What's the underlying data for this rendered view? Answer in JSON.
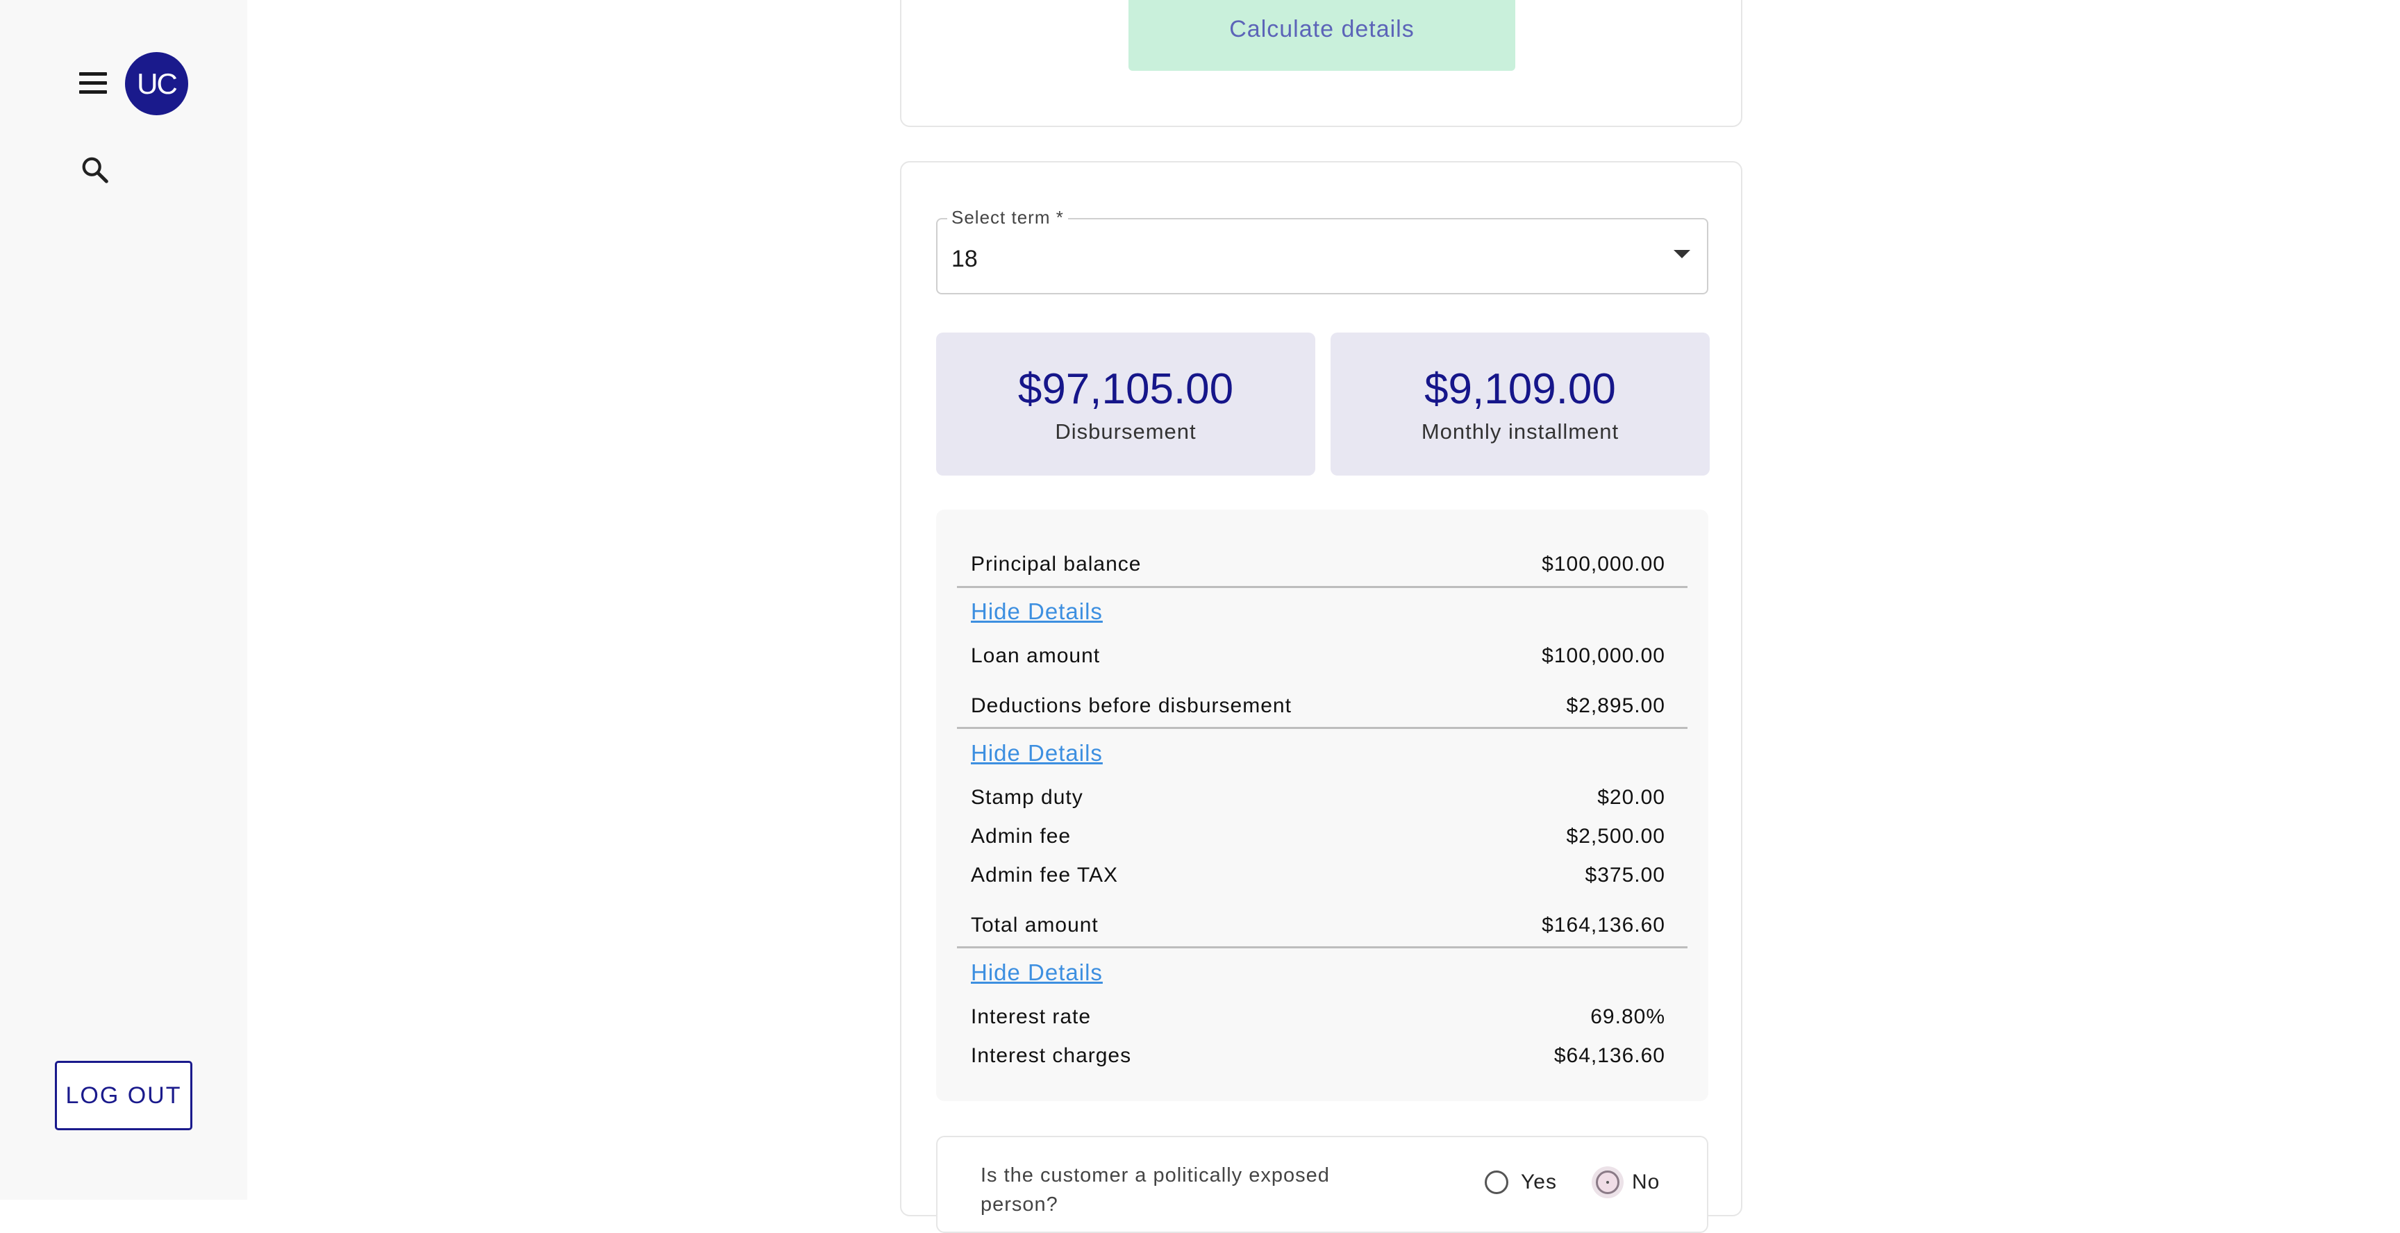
{
  "sidebar": {
    "avatar_initials": "UC",
    "logout_label": "LOG OUT"
  },
  "top_card": {
    "calculate_label": "Calculate details"
  },
  "term": {
    "label": "Select term *",
    "value": "18"
  },
  "summary": {
    "disbursement_amount": "$97,105.00",
    "disbursement_label": "Disbursement",
    "installment_amount": "$9,109.00",
    "installment_label": "Monthly installment"
  },
  "details": {
    "principal_label": "Principal balance",
    "principal_value": "$100,000.00",
    "hide_1": "Hide Details",
    "loan_amount_label": "Loan amount",
    "loan_amount_value": "$100,000.00",
    "deductions_label": "Deductions before disbursement",
    "deductions_value": "$2,895.00",
    "hide_2": "Hide Details",
    "stamp_duty_label": "Stamp duty",
    "stamp_duty_value": "$20.00",
    "admin_fee_label": "Admin fee",
    "admin_fee_value": "$2,500.00",
    "admin_fee_tax_label": "Admin fee TAX",
    "admin_fee_tax_value": "$375.00",
    "total_label": "Total amount",
    "total_value": "$164,136.60",
    "hide_3": "Hide Details",
    "interest_rate_label": "Interest rate",
    "interest_rate_value": "69.80%",
    "interest_charges_label": "Interest charges",
    "interest_charges_value": "$64,136.60"
  },
  "pep": {
    "question": "Is the customer a politically exposed person?",
    "yes_label": "Yes",
    "no_label": "No",
    "selected": "No"
  },
  "colors": {
    "brand": "#1a1a8c",
    "link": "#3d8fe0",
    "calculate_bg": "#c9f0db",
    "tile_bg": "#e8e7f2"
  }
}
